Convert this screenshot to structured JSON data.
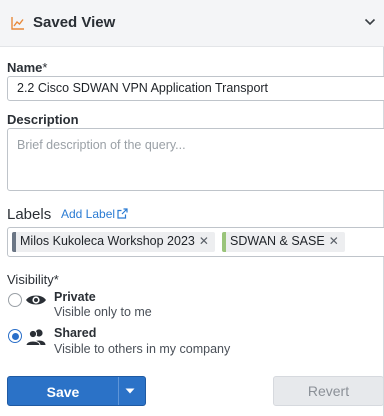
{
  "header": {
    "title": "Saved View",
    "icon": "line-chart-icon"
  },
  "name": {
    "label": "Name",
    "required_mark": "*",
    "value": "2.2 Cisco SDWAN VPN Application Transport"
  },
  "description": {
    "label": "Description",
    "placeholder": "Brief description of the query..."
  },
  "labels": {
    "title": "Labels",
    "add_label": "Add Label",
    "tags": [
      {
        "text": "Milos Kukoleca Workshop 2023",
        "color": "#6b7685"
      },
      {
        "text": "SDWAN & SASE",
        "color": "#9ac47a"
      }
    ]
  },
  "visibility": {
    "label": "Visibility",
    "required_mark": "*",
    "options": [
      {
        "title": "Private",
        "subtitle": "Visible only to me",
        "selected": false,
        "icon": "eye-icon"
      },
      {
        "title": "Shared",
        "subtitle": "Visible to others in my company",
        "selected": true,
        "icon": "users-icon"
      }
    ]
  },
  "actions": {
    "save": "Save",
    "revert": "Revert"
  },
  "colors": {
    "accent": "#2b72c7",
    "header_bg": "#f4f5f7",
    "chart_icon": "#e8893a"
  }
}
